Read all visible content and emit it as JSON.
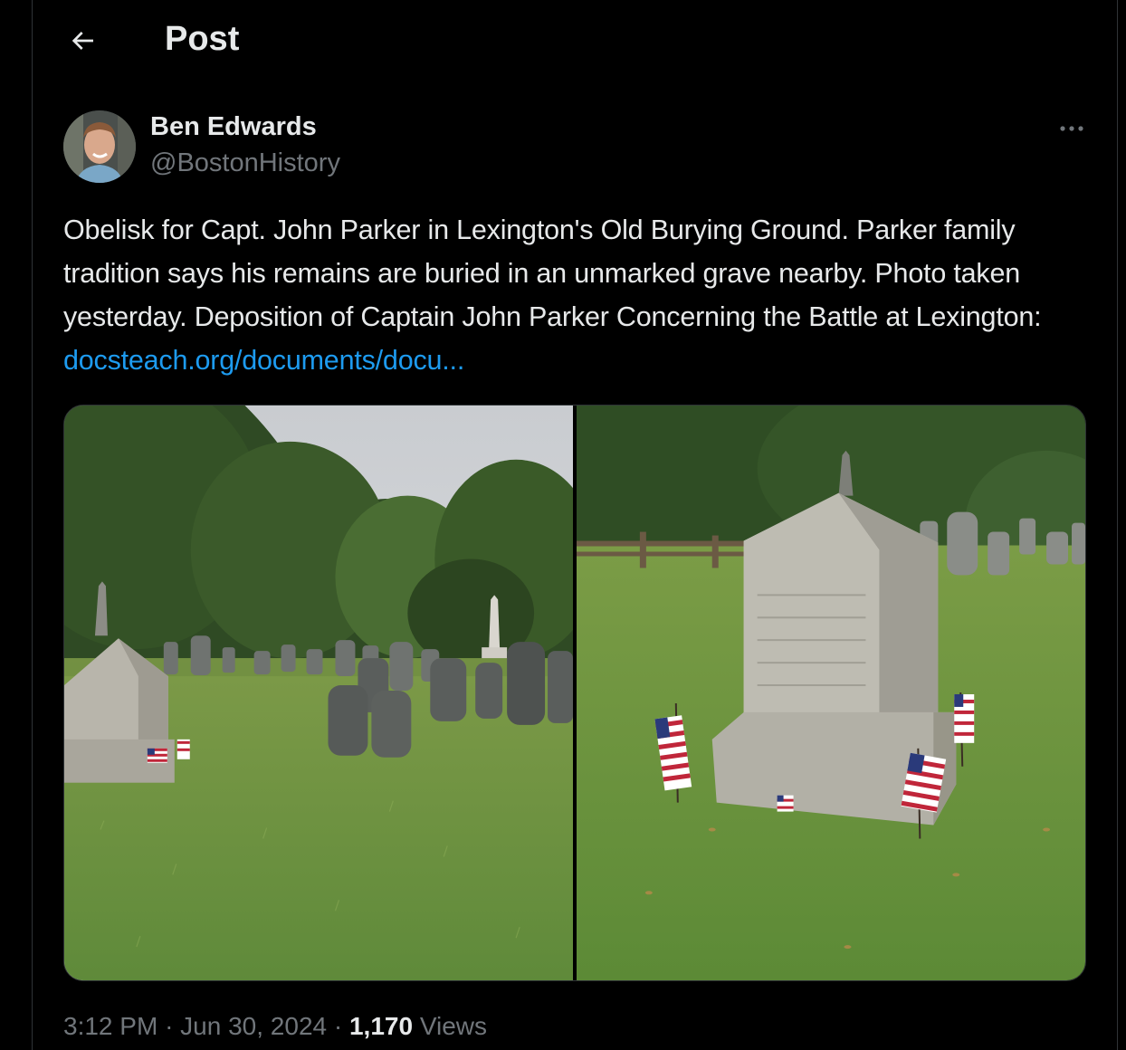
{
  "header": {
    "title": "Post",
    "back_icon": "arrow-left-icon"
  },
  "author": {
    "name": "Ben Edwards",
    "handle": "@BostonHistory",
    "more_icon": "more-horizontal-icon"
  },
  "post": {
    "text": "Obelisk for Capt. John Parker in Lexington's Old Burying Ground. Parker family tradition says his remains are buried in an unmarked grave nearby. Photo taken yesterday. Deposition of Captain John Parker Concerning the Battle at Lexington: ",
    "link_text": "docsteach.org/documents/docu..."
  },
  "meta": {
    "time": "3:12 PM",
    "separator": "·",
    "date": "Jun 30, 2024",
    "views_count": "1,170",
    "views_label": "Views"
  },
  "colors": {
    "background": "#000000",
    "text": "#e7e9ea",
    "secondary_text": "#71767b",
    "link": "#1d9bf0",
    "border": "#2f3336"
  }
}
